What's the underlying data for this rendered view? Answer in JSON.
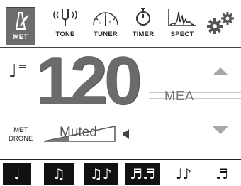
{
  "toolbar": {
    "items": [
      {
        "label": "MET",
        "icon": "metronome-icon",
        "active": true
      },
      {
        "label": "TONE",
        "icon": "tuning-fork-icon",
        "active": false
      },
      {
        "label": "TUNER",
        "icon": "tuner-dial-icon",
        "active": false
      },
      {
        "label": "TIMER",
        "icon": "stopwatch-icon",
        "active": false
      },
      {
        "label": "SPECT",
        "icon": "spectrum-icon",
        "active": false
      }
    ],
    "settings_icon": "gear-icon"
  },
  "tempo": {
    "note_symbol": "♩",
    "equals": "=",
    "bpm": "120"
  },
  "measure_label": "MEA",
  "drone": {
    "label_line1": "MET",
    "label_line2": "DRONE",
    "status": "Muted"
  },
  "subdivisions": [
    {
      "glyph": "♩",
      "icon": "quarter-note-icon",
      "style": "dark"
    },
    {
      "glyph": "♫",
      "icon": "eighth-notes-icon",
      "style": "dark"
    },
    {
      "glyph": "♫♪",
      "icon": "triplet-icon",
      "style": "dark"
    },
    {
      "glyph": "♬♬",
      "icon": "sixteenth-notes-icon",
      "style": "dark"
    },
    {
      "glyph": "♩♪",
      "icon": "dotted-rhythm-icon",
      "style": "light"
    },
    {
      "glyph": "♬",
      "icon": "swing-rhythm-icon",
      "style": "light"
    }
  ],
  "colors": {
    "active_tab": "#6d6d6d",
    "tempo_digits": "#6b6b6b",
    "arrows": "#a8a8a8",
    "subdivision_dark": "#111111"
  }
}
